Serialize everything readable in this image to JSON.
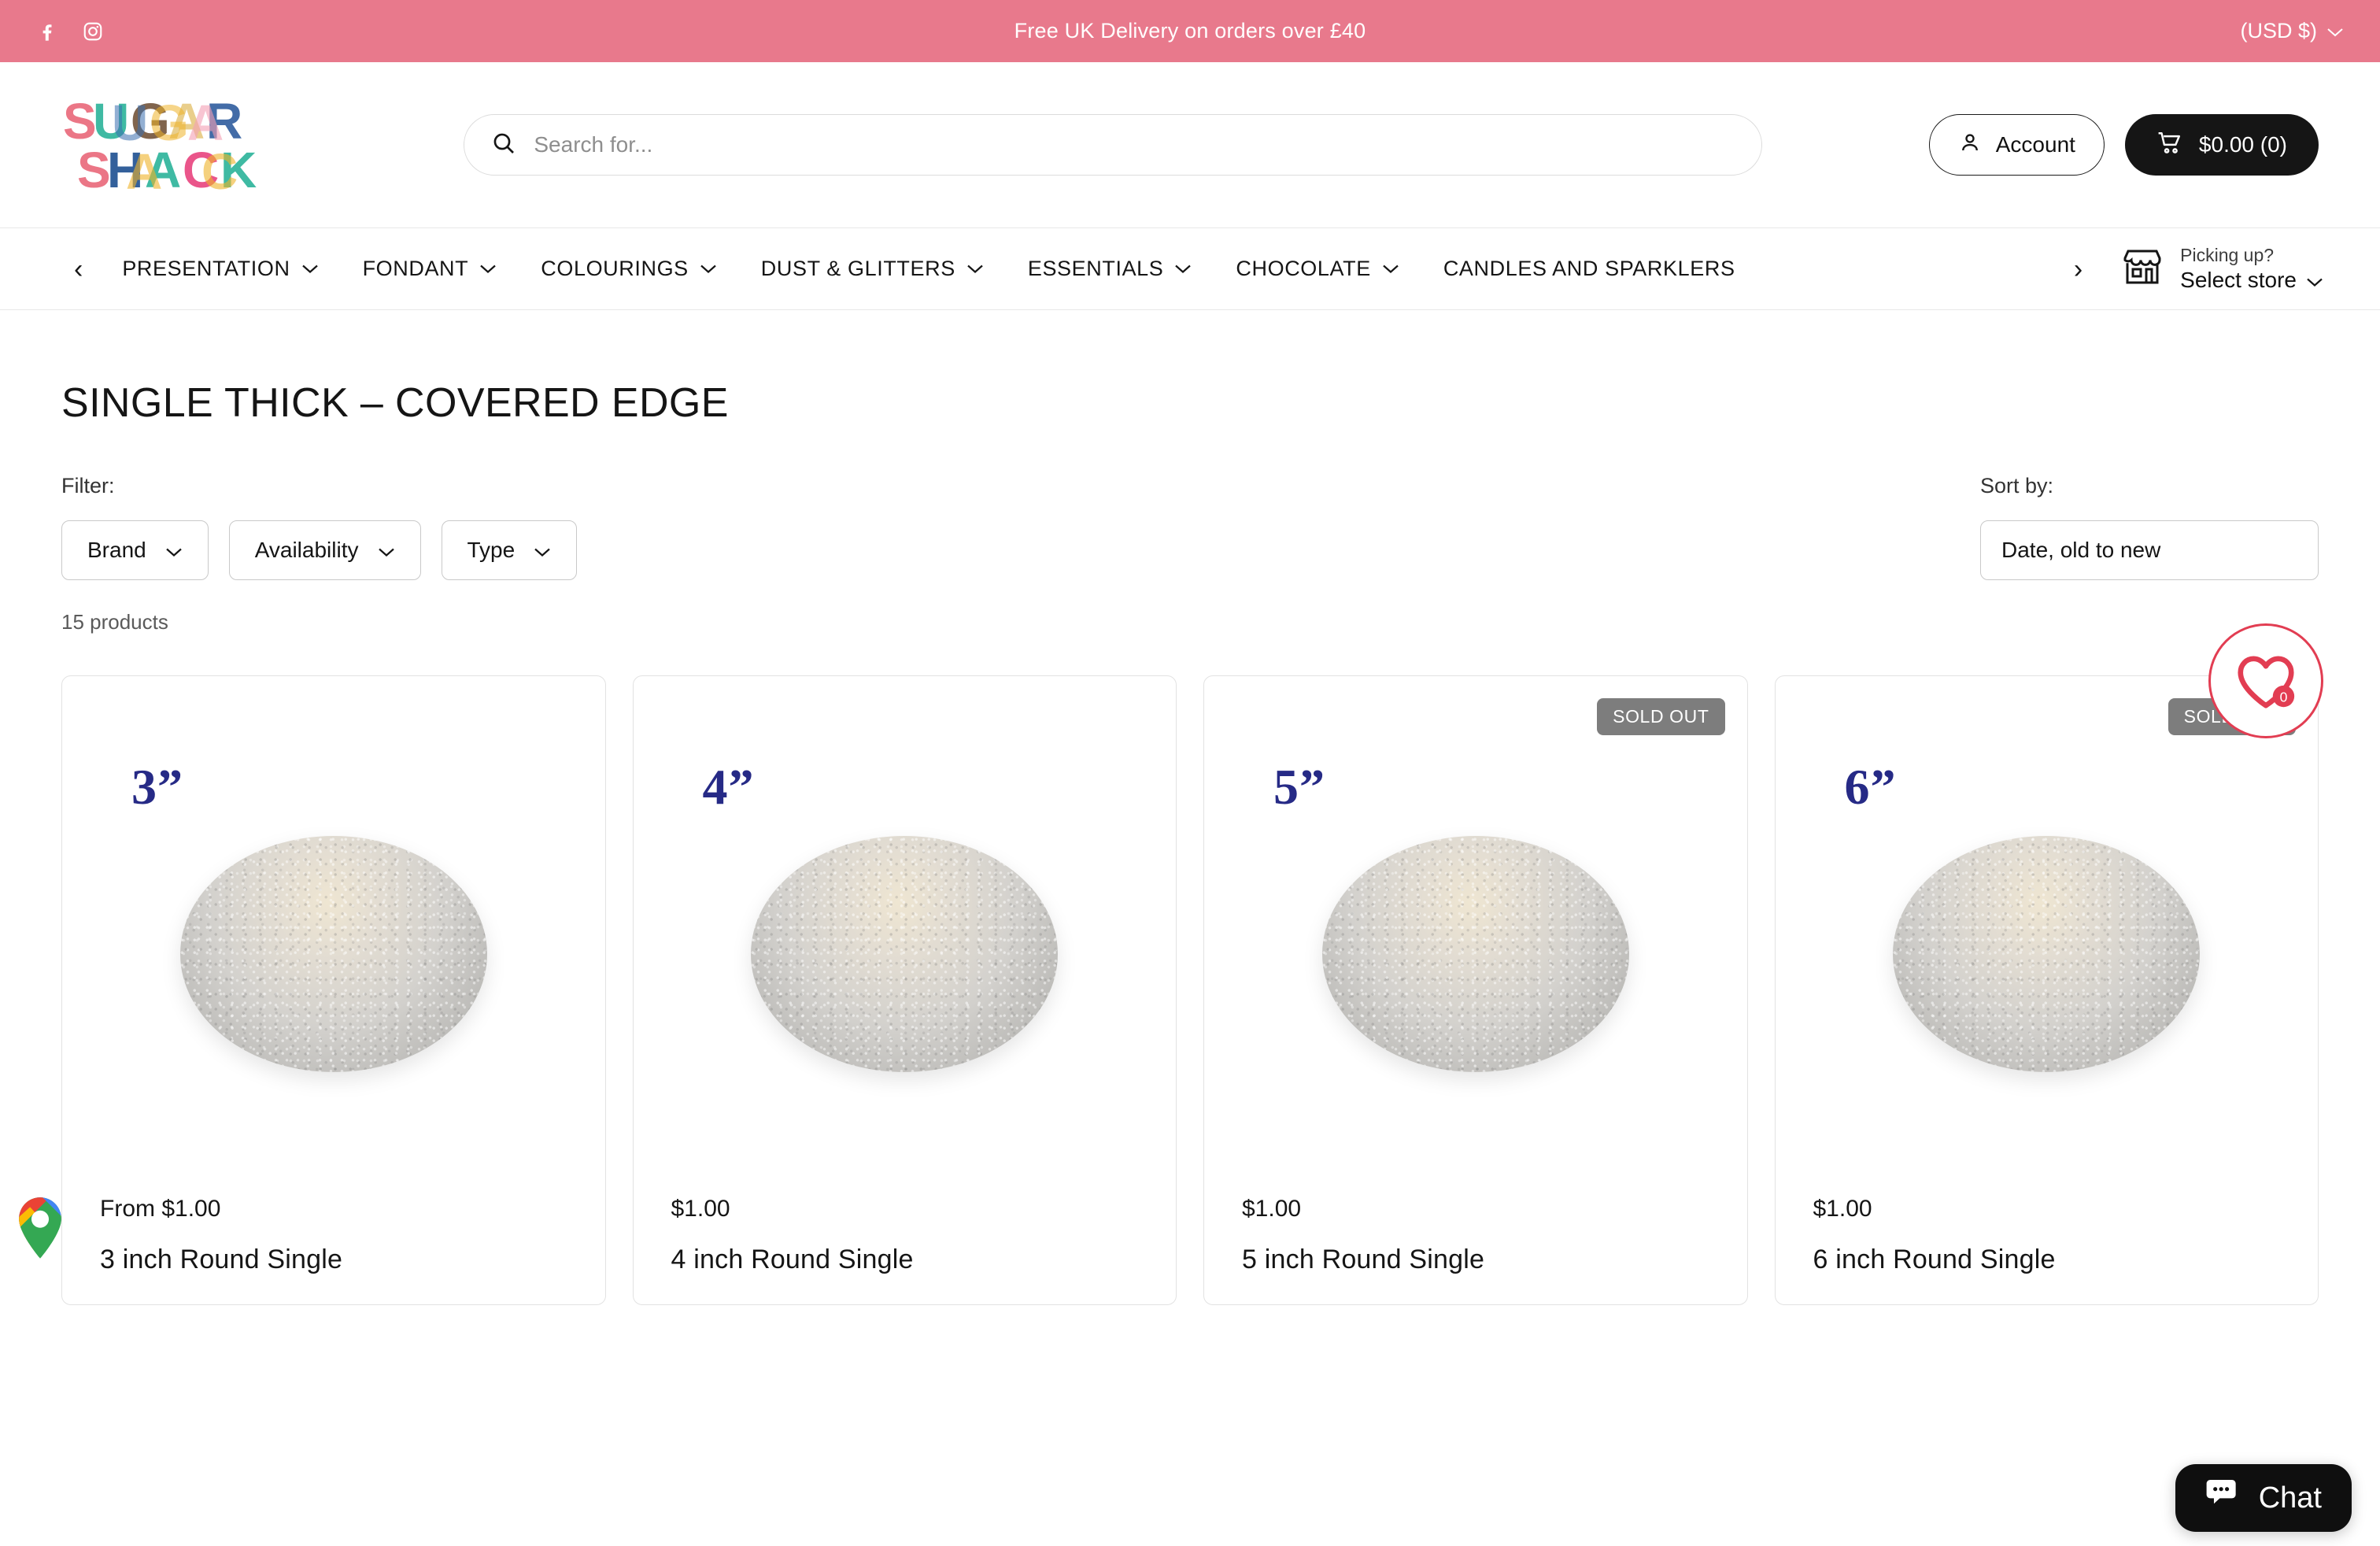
{
  "announcement": {
    "text": "Free UK Delivery on orders over £40",
    "currency": "(USD $)",
    "social": [
      "facebook-icon",
      "instagram-icon"
    ],
    "background": "#e8798c"
  },
  "header": {
    "logo_line1": "SUGAR",
    "logo_line2": "SHACK",
    "search_placeholder": "Search for...",
    "search_value": "",
    "account_label": "Account",
    "cart_label": "$0.00 (0)"
  },
  "nav": {
    "prev_arrow": "‹",
    "next_arrow": "›",
    "items": [
      {
        "label": "PRESENTATION",
        "has_dropdown": true
      },
      {
        "label": "FONDANT",
        "has_dropdown": true
      },
      {
        "label": "COLOURINGS",
        "has_dropdown": true
      },
      {
        "label": "DUST & GLITTERS",
        "has_dropdown": true
      },
      {
        "label": "ESSENTIALS",
        "has_dropdown": true
      },
      {
        "label": "CHOCOLATE",
        "has_dropdown": true
      },
      {
        "label": "CANDLES AND SPARKLERS",
        "has_dropdown": false
      }
    ],
    "pickup_prompt": "Picking up?",
    "pickup_action": "Select store"
  },
  "collection": {
    "title": "SINGLE THICK – COVERED EDGE",
    "filter_label": "Filter:",
    "filters": [
      {
        "label": "Brand"
      },
      {
        "label": "Availability"
      },
      {
        "label": "Type"
      }
    ],
    "product_count": "15 products",
    "sort_label": "Sort by:",
    "sort_value": "Date, old to new"
  },
  "wishlist": {
    "count": "0",
    "accent": "#e23d52"
  },
  "products": [
    {
      "size_label": "3”",
      "price": "From $1.00",
      "title": "3 inch Round Single",
      "sold_out": false,
      "badge": ""
    },
    {
      "size_label": "4”",
      "price": "$1.00",
      "title": "4 inch Round Single",
      "sold_out": false,
      "badge": ""
    },
    {
      "size_label": "5”",
      "price": "$1.00",
      "title": "5 inch Round Single",
      "sold_out": true,
      "badge": "SOLD OUT"
    },
    {
      "size_label": "6”",
      "price": "$1.00",
      "title": "6 inch Round Single",
      "sold_out": true,
      "badge": "SOLD OUT"
    }
  ],
  "chat": {
    "label": "Chat"
  }
}
